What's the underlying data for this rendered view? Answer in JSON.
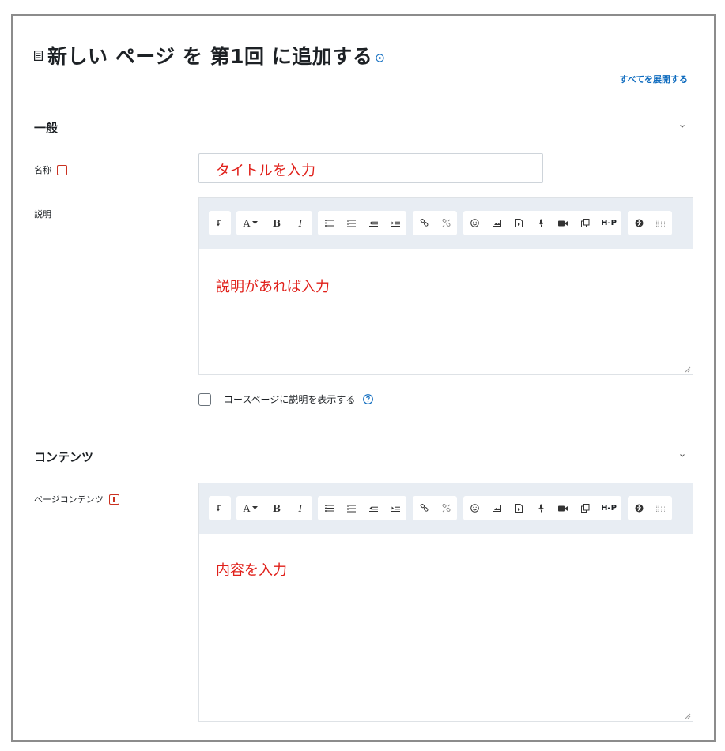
{
  "page": {
    "title": "新しい ページ を 第1回 に追加する",
    "expand_all": "すべてを展開する"
  },
  "general": {
    "title": "一般",
    "name_label": "名称",
    "name_value": "タイトルを入力",
    "description_label": "説明",
    "description_value": "説明があれば入力",
    "show_description_label": "コースページに説明を表示する"
  },
  "content": {
    "title": "コンテンツ",
    "page_content_label": "ページコンテンツ",
    "page_content_value": "内容を入力"
  },
  "toolbar": {
    "text_style_label": "A",
    "bold_label": "B",
    "italic_label": "I",
    "h5p_label": "H-P"
  },
  "colors": {
    "accent": "#0f6cbf",
    "required": "#ca3120",
    "annotation": "#e0201a",
    "toolbar_bg": "#e8edf3"
  }
}
